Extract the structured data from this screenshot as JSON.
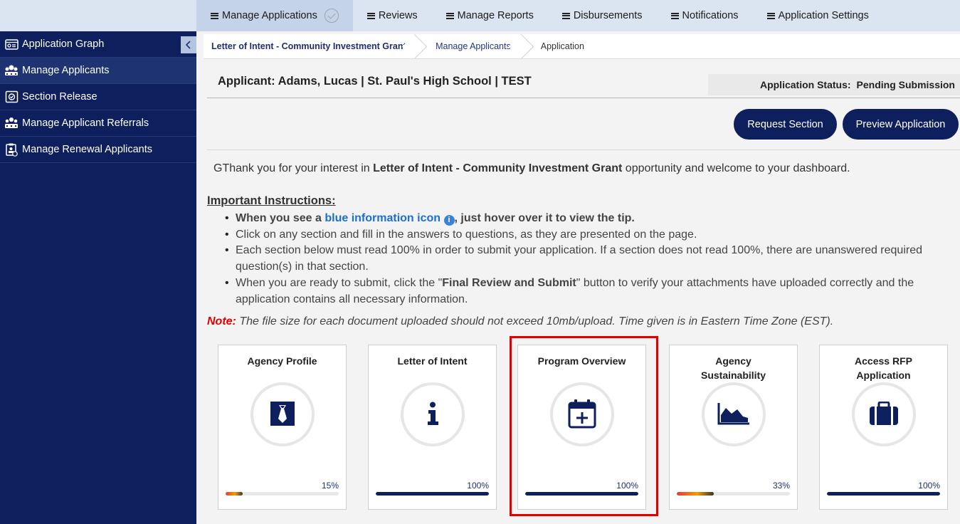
{
  "topnav": [
    {
      "label": "Manage Applications",
      "active": true
    },
    {
      "label": "Reviews"
    },
    {
      "label": "Manage Reports"
    },
    {
      "label": "Disbursements"
    },
    {
      "label": "Notifications"
    },
    {
      "label": "Application Settings"
    }
  ],
  "sidebar": {
    "items": [
      {
        "label": "Application Graph",
        "icon": "graph-icon"
      },
      {
        "label": "Manage Applicants",
        "icon": "users-icon",
        "active": true
      },
      {
        "label": "Section Release",
        "icon": "release-icon"
      },
      {
        "label": "Manage Applicant Referrals",
        "icon": "referral-icon"
      },
      {
        "label": "Manage Renewal Applicants",
        "icon": "renewal-icon"
      }
    ]
  },
  "breadcrumb": [
    "Letter of Intent - Community Investment Grant.",
    "Manage Applicants",
    "Application"
  ],
  "applicant": {
    "text": "Applicant: Adams, Lucas | St. Paul's High School | TEST",
    "status_label": "Application Status:",
    "status_value": "Pending Submission"
  },
  "buttons": {
    "request": "Request Section",
    "preview": "Preview Application"
  },
  "welcome": {
    "pre": "GThank you for your interest in ",
    "bold": "Letter of Intent - Community Investment Grant",
    "post": " opportunity and welcome to your dashboard."
  },
  "instructions": {
    "title": "Important Instructions:",
    "item1_pre": "When you see a ",
    "item1_blue": "blue information icon",
    "item1_post": ", just hover over it to view the tip.",
    "item2": "Click on any section and fill in the answers to questions, as they are presented on the page.",
    "item3": "Each section below must read 100% in order to submit your application. If a section does not read 100%, there are unanswered required question(s) in that section.",
    "item4_pre": "When you are ready to submit, click the \"",
    "item4_bold": "Final Review and Submit",
    "item4_post": "\" button to verify your attachments have uploaded correctly and the application contains all necessary information."
  },
  "note": {
    "label": "Note:",
    "text": " The file size for each document uploaded should not exceed 10mb/upload. Time given is in Eastern Time Zone (EST)."
  },
  "cards": [
    {
      "title": "Agency Profile",
      "icon": "tie-icon",
      "percent_label": "15%",
      "progress": 0.15,
      "gradient": true
    },
    {
      "title": "Letter of Intent",
      "icon": "info-icon",
      "percent_label": "100%",
      "progress": 1.0
    },
    {
      "title": "Program Overview",
      "icon": "calendar-plus-icon",
      "percent_label": "100%",
      "progress": 1.0,
      "highlighted": true
    },
    {
      "title": "Agency Sustainability",
      "icon": "area-chart-icon",
      "percent_label": "33%",
      "progress": 0.33,
      "gradient": true
    },
    {
      "title": "Access RFP Application",
      "icon": "briefcase-icon",
      "percent_label": "100%",
      "progress": 1.0
    }
  ],
  "colors": {
    "navy": "#0e1f5e",
    "highlight": "#e00000",
    "progress_gradient": [
      "#e53935",
      "#ff9800",
      "#333333"
    ]
  }
}
